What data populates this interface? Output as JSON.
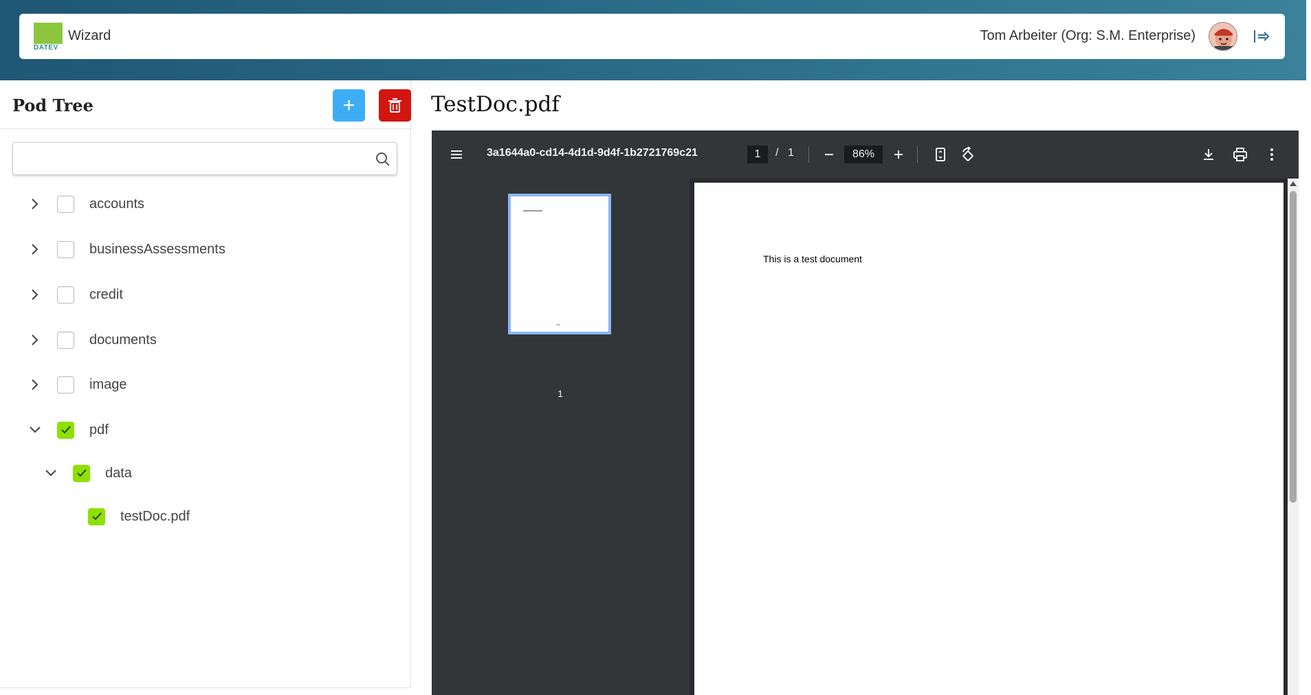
{
  "header": {
    "logo_text": "DATEV",
    "app_title": "Wizard",
    "user_label": "Tom Arbeiter (Org: S.M. Enterprise)"
  },
  "pod_tree": {
    "title": "Pod Tree",
    "add_label": "+",
    "search_placeholder": "",
    "items": [
      {
        "label": "accounts",
        "expanded": false,
        "checked": false
      },
      {
        "label": "businessAssessments",
        "expanded": false,
        "checked": false
      },
      {
        "label": "credit",
        "expanded": false,
        "checked": false
      },
      {
        "label": "documents",
        "expanded": false,
        "checked": false
      },
      {
        "label": "image",
        "expanded": false,
        "checked": false
      },
      {
        "label": "pdf",
        "expanded": true,
        "checked": true
      },
      {
        "label": "data",
        "expanded": true,
        "checked": true
      },
      {
        "label": "testDoc.pdf",
        "checked": true
      }
    ]
  },
  "document": {
    "title": "TestDoc.pdf"
  },
  "viewer": {
    "file_name": "3a1644a0-cd14-4d1d-9d4f-1b2721769c21",
    "current_page": "1",
    "separator": "/",
    "total_pages": "1",
    "zoom": "86%",
    "thumbnail_page_number": "1",
    "page_text": "This is a  test document"
  },
  "colors": {
    "header_gradient_start": "#1f5774",
    "header_gradient_end": "#3a8199",
    "add_button": "#3daef5",
    "delete_button": "#d1160f",
    "checkbox_checked": "#8ee000",
    "viewer_toolbar": "#323639",
    "thumbnail_border": "#8ab4f8"
  }
}
